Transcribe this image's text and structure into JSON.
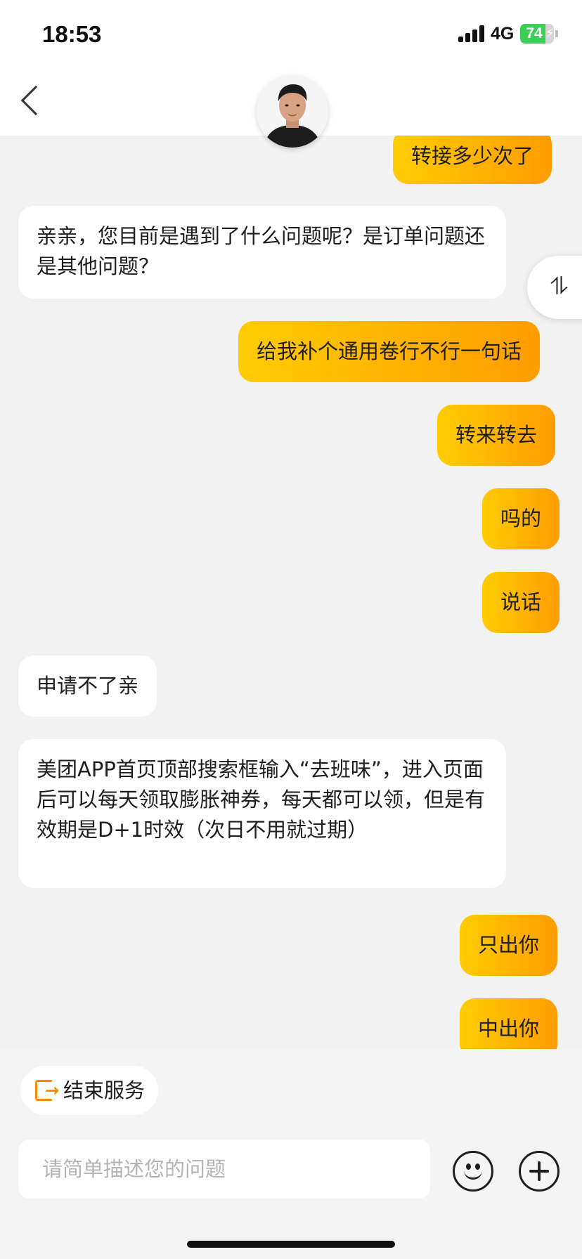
{
  "status_bar": {
    "time": "18:53",
    "network": "4G",
    "battery_level": "74",
    "battery_fraction": 0.74,
    "battery_color": "#3ecd57"
  },
  "header": {
    "back_icon": "chevron-left-icon",
    "avatar_icon": "agent-avatar"
  },
  "messages": [
    {
      "side": "out",
      "text": "转接多少次了"
    },
    {
      "side": "in",
      "text": "亲亲，您目前是遇到了什么问题呢？是订单问题还是其他问题？"
    },
    {
      "side": "out",
      "text": "给我补个通用卷行不行一句话"
    },
    {
      "side": "out",
      "text": "转来转去"
    },
    {
      "side": "out",
      "text": "吗的"
    },
    {
      "side": "out",
      "text": "说话"
    },
    {
      "side": "in",
      "text": "申请不了亲"
    },
    {
      "side": "in",
      "text": "美团APP首页顶部搜索框输入“去班味”，进入页面后可以每天领取膨胀神券，每天都可以领，但是有效期是D+1时效（次日不用就过期）"
    },
    {
      "side": "out",
      "text": "只出你"
    },
    {
      "side": "out",
      "text": "中出你"
    }
  ],
  "side_toggle": {
    "glyph": "⥮",
    "icon": "swap-vertical-icon"
  },
  "bottom": {
    "end_service_label": "结束服务",
    "input_placeholder": "请简单描述您的问题",
    "input_value": "",
    "emoji_icon": "smiley-icon",
    "plus_icon": "plus-circle-icon"
  },
  "colors": {
    "outgoing_start": "#ffcc02",
    "outgoing_end": "#ff9d00",
    "end_service_accent": "#ff8a00",
    "background": "#f2f2f2"
  }
}
